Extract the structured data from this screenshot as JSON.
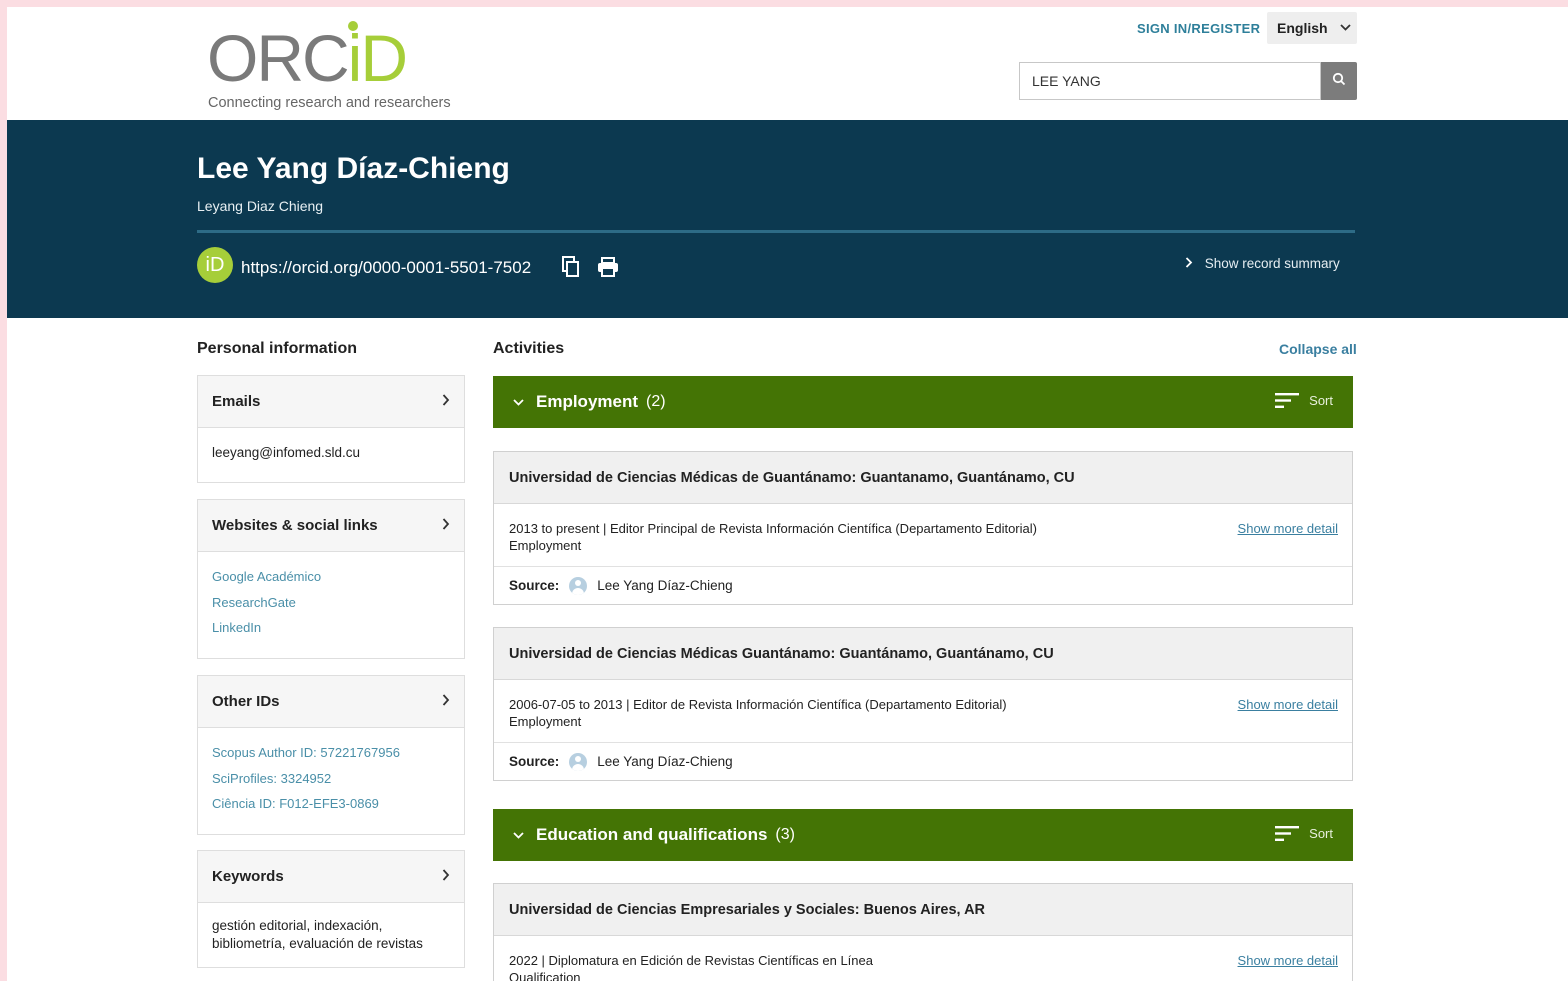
{
  "header": {
    "logo_text": "ORCID",
    "tagline": "Connecting research and researchers",
    "signin_label": "SIGN IN/REGISTER",
    "language": "English",
    "search_value": "LEE YANG"
  },
  "profile": {
    "name": "Lee Yang Díaz-Chieng",
    "alias": "Leyang Diaz Chieng",
    "orcid_badge": "iD",
    "orcid_url": "https://orcid.org/0000-0001-5501-7502",
    "show_summary_label": "Show record summary"
  },
  "personal": {
    "heading": "Personal information",
    "emails": {
      "title": "Emails",
      "items": [
        "leeyang@infomed.sld.cu"
      ]
    },
    "websites": {
      "title": "Websites & social links",
      "items": [
        "Google Académico",
        "ResearchGate",
        "LinkedIn"
      ]
    },
    "other_ids": {
      "title": "Other IDs",
      "items": [
        "Scopus Author ID: 57221767956",
        "SciProfiles: 3324952",
        "Ciência ID: F012-EFE3-0869"
      ]
    },
    "keywords": {
      "title": "Keywords",
      "text": "gestión editorial, indexación, bibliometría, evaluación de revistas"
    }
  },
  "activities": {
    "heading": "Activities",
    "collapse_all": "Collapse all",
    "sort_label": "Sort",
    "show_more": "Show more detail",
    "source_label": "Source:",
    "employment": {
      "title": "Employment",
      "count": "(2)",
      "items": [
        {
          "org": "Universidad de Ciencias Médicas de Guantánamo: Guantanamo, Guantánamo, CU",
          "line1": "2013 to present | Editor Principal de Revista Información Científica (Departamento Editorial)",
          "line2": "Employment",
          "source": "Lee Yang Díaz-Chieng"
        },
        {
          "org": "Universidad de Ciencias Médicas Guantánamo: Guantánamo, Guantánamo, CU",
          "line1": "2006-07-05 to 2013 | Editor de Revista Información Científica (Departamento Editorial)",
          "line2": "Employment",
          "source": "Lee Yang Díaz-Chieng"
        }
      ]
    },
    "education": {
      "title": "Education and qualifications",
      "count": "(3)",
      "items": [
        {
          "org": "Universidad de Ciencias Empresariales y Sociales: Buenos Aires, AR",
          "line1": "2022 | Diplomatura en Edición de Revistas Científicas en Línea",
          "line2": "Qualification"
        }
      ]
    }
  },
  "colors": {
    "banner": "#0c3950",
    "section_green": "#447405",
    "orcid_green": "#a6ce39",
    "link_blue": "#3a7fa0"
  },
  "icons": [
    "search-icon",
    "chevron-down-icon",
    "copy-icon",
    "print-icon",
    "chevron-right-icon",
    "sort-icon",
    "user-avatar-icon"
  ]
}
